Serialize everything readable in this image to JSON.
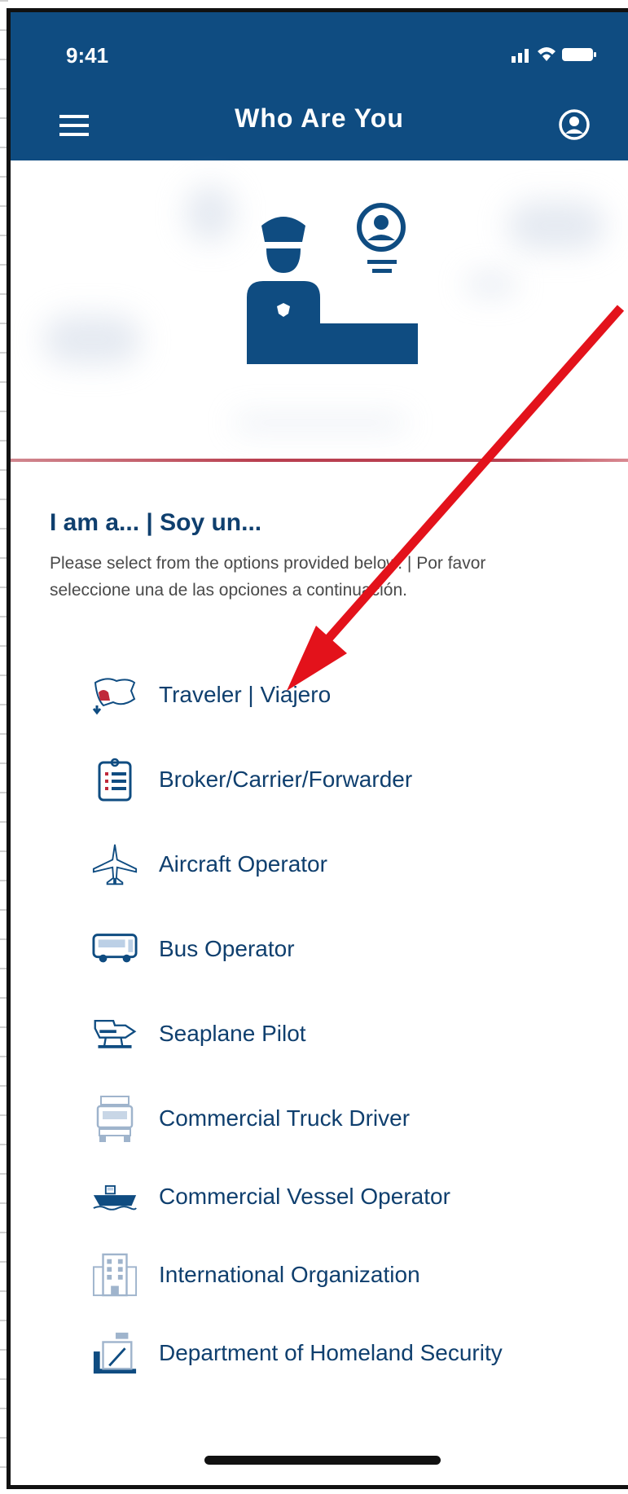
{
  "status": {
    "time": "9:41"
  },
  "header": {
    "title": "Who Are You"
  },
  "section": {
    "title": "I am a... | Soy un...",
    "description": "Please select from the options provided below. | Por favor seleccione una de las opciones a continuación."
  },
  "options": [
    {
      "label": "Traveler | Viajero",
      "icon": "map-icon"
    },
    {
      "label": "Broker/Carrier/Forwarder",
      "icon": "clipboard-icon"
    },
    {
      "label": "Aircraft Operator",
      "icon": "airplane-icon"
    },
    {
      "label": "Bus Operator",
      "icon": "bus-icon"
    },
    {
      "label": "Seaplane Pilot",
      "icon": "seaplane-icon"
    },
    {
      "label": "Commercial Truck Driver",
      "icon": "truck-icon"
    },
    {
      "label": "Commercial Vessel Operator",
      "icon": "ship-icon"
    },
    {
      "label": "International Organization",
      "icon": "building-icon"
    },
    {
      "label": "Department of Homeland Security",
      "icon": "officer-desk-icon"
    }
  ],
  "colors": {
    "brand": "#0f4c81",
    "accent_line": "#b94050",
    "text": "#0f3f6e",
    "annotation_arrow": "#e3121b"
  }
}
